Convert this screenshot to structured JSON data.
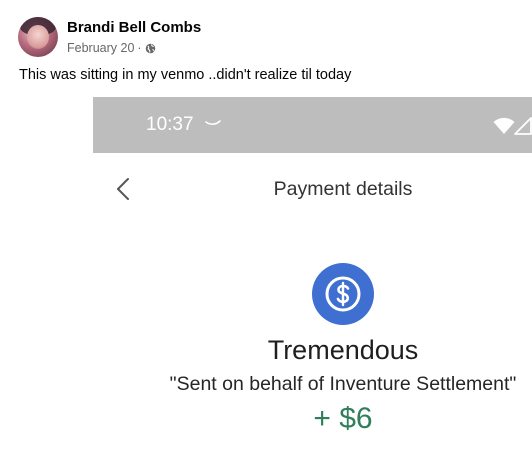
{
  "post": {
    "author_name": "Brandi Bell Combs",
    "date": "February 20",
    "separator": "·",
    "caption": "This was sitting in my venmo ..didn't realize til today"
  },
  "phone": {
    "status_time": "10:37",
    "screen_title": "Payment details",
    "merchant": "Tremendous",
    "memo": "\"Sent on behalf of Inventure Settlement\"",
    "amount": "+ $6",
    "colors": {
      "status_bar": "#bdbdbd",
      "icon_circle": "#3f6fd0",
      "amount_green": "#2f7f5a"
    }
  },
  "icons": {
    "audience": "globe-icon",
    "back": "chevron-left-icon",
    "payment": "dollar-icon",
    "wifi": "wifi-icon",
    "signal": "signal-icon"
  }
}
